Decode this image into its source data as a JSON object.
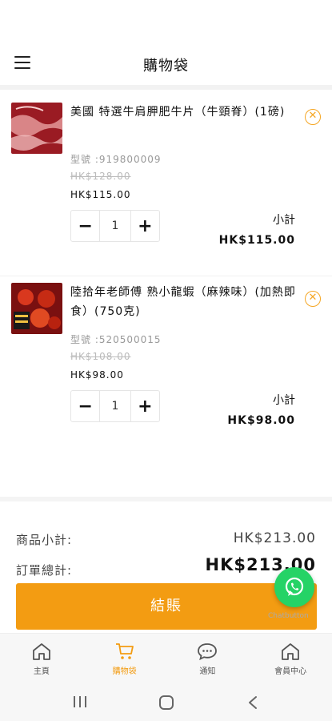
{
  "header": {
    "title": "購物袋",
    "menu_icon": "hamburger-menu-icon"
  },
  "cart_items": [
    {
      "name": "美國 特選牛肩胛肥牛片（牛頸脊）(1磅)",
      "sku": "型號 :919800009",
      "original_price": "HK$128.00",
      "price": "HK$115.00",
      "quantity": "1",
      "subtotal_label": "小計",
      "subtotal": "HK$115.00"
    },
    {
      "name": "陸拾年老師傅 熟小龍蝦（麻辣味）(加熱即食）(750克)",
      "sku": "型號 :520500015",
      "original_price": "HK$108.00",
      "price": "HK$98.00",
      "quantity": "1",
      "subtotal_label": "小計",
      "subtotal": "HK$98.00"
    }
  ],
  "summary": {
    "items_subtotal_label": "商品小計:",
    "items_subtotal": "HK$213.00",
    "order_total_label": "訂單總計:",
    "order_total": "HK$213.00"
  },
  "checkout": {
    "label": "結賬"
  },
  "whatsapp": {
    "caption": "Chatbutton"
  },
  "tabbar": {
    "tabs": [
      {
        "label": "主頁",
        "icon": "home-icon",
        "active": false
      },
      {
        "label": "購物袋",
        "icon": "cart-icon",
        "active": true
      },
      {
        "label": "通知",
        "icon": "chat-bubble-icon",
        "active": false
      },
      {
        "label": "會員中心",
        "icon": "member-home-icon",
        "active": false
      }
    ]
  },
  "colors": {
    "accent": "#f39c12",
    "whatsapp": "#25d366",
    "remove": "#f5a623"
  }
}
